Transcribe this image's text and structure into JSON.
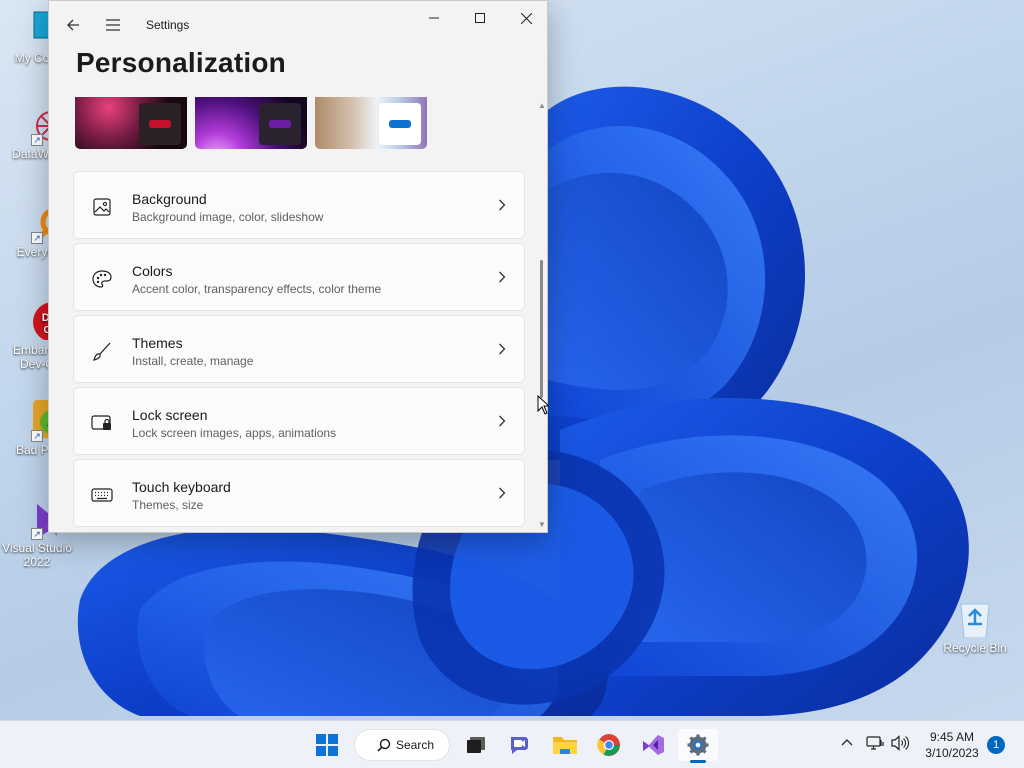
{
  "desktop": {
    "icons": [
      {
        "label": "My Com",
        "icon": "computer-icon"
      },
      {
        "label": "DataWag",
        "icon": "datawag-icon"
      },
      {
        "label": "Everyth",
        "icon": "everything-search-icon"
      },
      {
        "label_line1": "Embarca",
        "label_line2": "Dev-C",
        "icon": "dev-cpp-icon",
        "badge": "DEV C++"
      },
      {
        "label": "Bad Pig",
        "icon": "bad-piggies-icon"
      },
      {
        "label_line1": "Visual Studio",
        "label_line2": "2022",
        "icon": "visual-studio-icon"
      }
    ],
    "recycle_bin": {
      "label": "Recycle Bin",
      "icon": "recycle-bin-icon"
    }
  },
  "settings": {
    "app_title": "Settings",
    "page_title": "Personalization",
    "themes": [
      {
        "name": "theme-glow",
        "accent": "#c8102e"
      },
      {
        "name": "theme-sunrise",
        "accent": "#6b1fa6"
      },
      {
        "name": "theme-captured-motion",
        "accent": "#0a72d1"
      }
    ],
    "cards": [
      {
        "title": "Background",
        "subtitle": "Background image, color, slideshow",
        "icon": "image-icon"
      },
      {
        "title": "Colors",
        "subtitle": "Accent color, transparency effects, color theme",
        "icon": "palette-icon"
      },
      {
        "title": "Themes",
        "subtitle": "Install, create, manage",
        "icon": "brush-icon"
      },
      {
        "title": "Lock screen",
        "subtitle": "Lock screen images, apps, animations",
        "icon": "lock-screen-icon"
      },
      {
        "title": "Touch keyboard",
        "subtitle": "Themes, size",
        "icon": "keyboard-icon"
      }
    ]
  },
  "taskbar": {
    "search_label": "Search",
    "apps": [
      "start-icon",
      "task-view-icon",
      "meet-icon",
      "file-explorer-icon",
      "chrome-icon",
      "visual-studio-icon",
      "settings-icon"
    ],
    "time": "9:45 AM",
    "date": "3/10/2023",
    "notification_count": "1"
  },
  "colors": {
    "accent": "#0067c0",
    "window_bg": "#f3f3f3",
    "card_bg": "#fbfbfb"
  }
}
